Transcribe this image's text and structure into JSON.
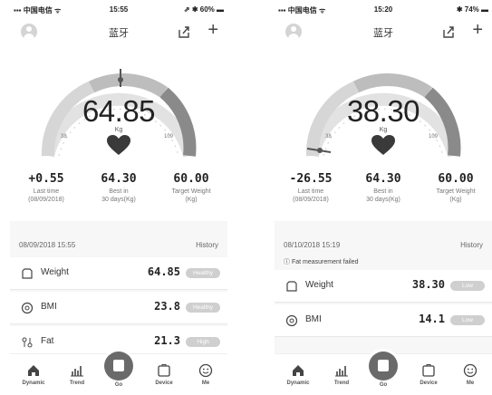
{
  "colors": {
    "accent": "#6a6a6a",
    "arc_light": "#d6d6d6",
    "arc_mid": "#bdbdbd",
    "arc_dark": "#8a8a8a",
    "badge": "#cfcfcf"
  },
  "screens": [
    {
      "status": {
        "carrier": "▪▪▪ 中国电信 ᯤ",
        "time": "15:55",
        "battery": "⇗ ✱ 60% ▬"
      },
      "header": {
        "title": "蓝牙",
        "share_icon": "share-icon",
        "add_icon": "plus-icon",
        "add_label": "+"
      },
      "gauge": {
        "reading": "64.85",
        "unit": "Kg",
        "min_label": "38",
        "max_label": "109",
        "level": 0.45
      },
      "stats": [
        {
          "value": "+0.55",
          "label_1": "Last time",
          "label_2": "(08/09/2018)"
        },
        {
          "value": "64.30",
          "label_1": "Best in",
          "label_2": "30 days(Kg)"
        },
        {
          "value": "60.00",
          "label_1": "Target Weight",
          "label_2": "(Kg)"
        }
      ],
      "list": {
        "date": "08/09/2018 15:55",
        "history": "History",
        "warning": "",
        "rows": [
          {
            "icon": "weight-icon",
            "label": "Weight",
            "value": "64.85",
            "badge": "Healthy"
          },
          {
            "icon": "bmi-icon",
            "label": "BMI",
            "value": "23.8",
            "badge": "Healthy"
          },
          {
            "icon": "fat-icon",
            "label": "Fat",
            "value": "21.3",
            "badge": "High"
          }
        ]
      }
    },
    {
      "status": {
        "carrier": "▪▪▪ 中国电信 ᯤ",
        "time": "15:20",
        "battery": "✱ 74% ▬"
      },
      "header": {
        "title": "蓝牙",
        "share_icon": "share-icon",
        "add_icon": "plus-icon",
        "add_label": "+"
      },
      "gauge": {
        "reading": "38.30",
        "unit": "Kg",
        "min_label": "38",
        "max_label": "109",
        "level": 0.0
      },
      "stats": [
        {
          "value": "-26.55",
          "label_1": "Last time",
          "label_2": "(08/09/2018)"
        },
        {
          "value": "64.30",
          "label_1": "Best in",
          "label_2": "30 days(Kg)"
        },
        {
          "value": "60.00",
          "label_1": "Target Weight",
          "label_2": "(Kg)"
        }
      ],
      "list": {
        "date": "08/10/2018 15:19",
        "history": "History",
        "warning": "ⓘ Fat measurement failed",
        "rows": [
          {
            "icon": "weight-icon",
            "label": "Weight",
            "value": "38.30",
            "badge": "Low"
          },
          {
            "icon": "bmi-icon",
            "label": "BMI",
            "value": "14.1",
            "badge": "Low"
          }
        ]
      }
    }
  ],
  "tabbar": {
    "tabs": [
      {
        "icon": "home-icon",
        "label": "Dynamic"
      },
      {
        "icon": "trend-icon",
        "label": "Trend"
      },
      {
        "icon": "go-icon",
        "label": "Go"
      },
      {
        "icon": "device-icon",
        "label": "Device"
      },
      {
        "icon": "smile-icon",
        "label": "Me"
      }
    ]
  }
}
